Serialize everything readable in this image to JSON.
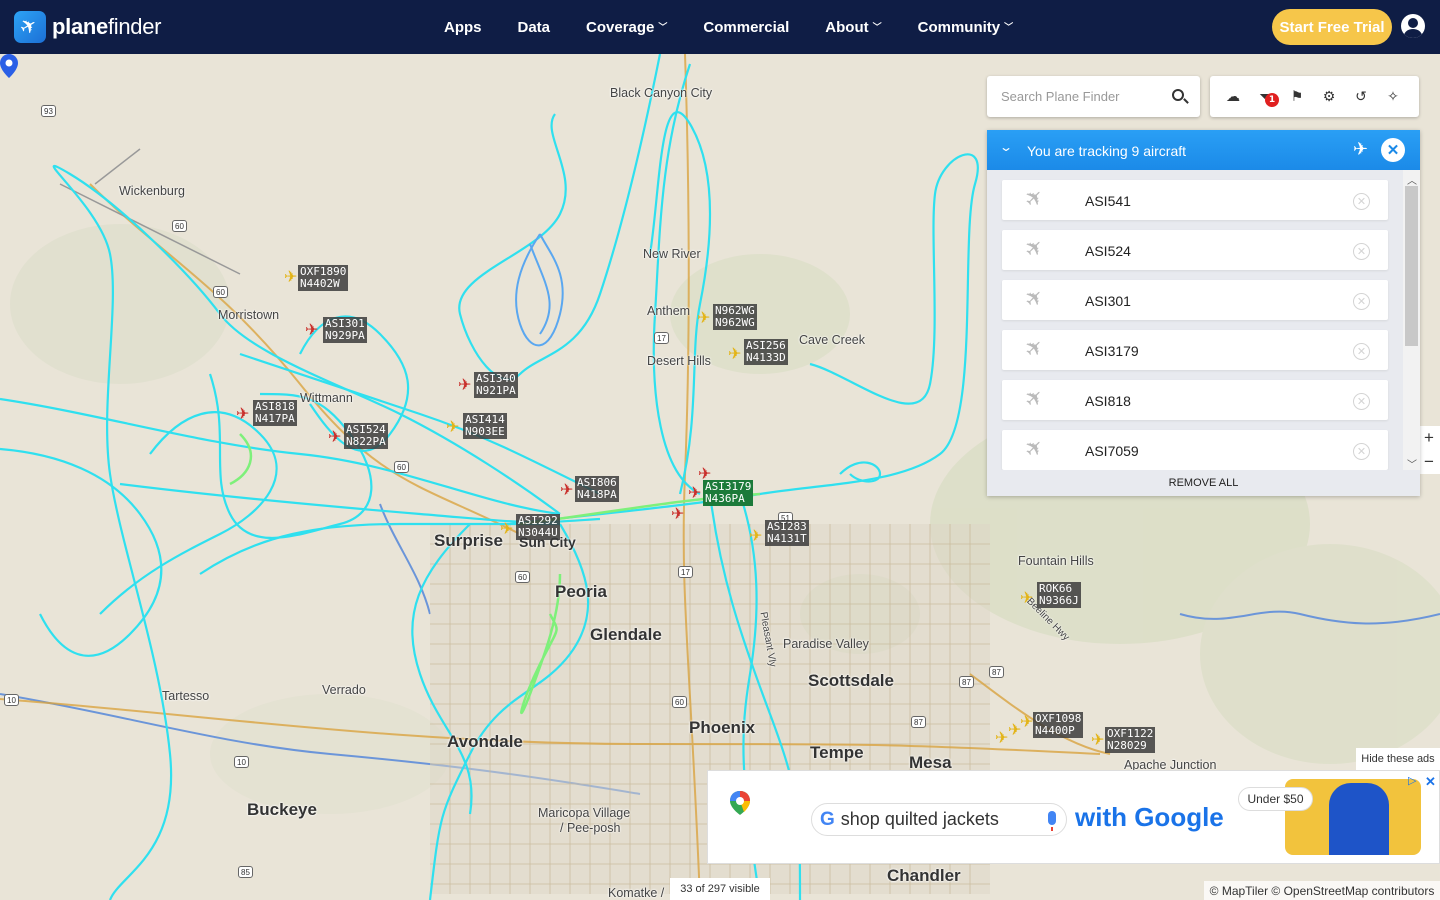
{
  "brand": {
    "name_bold": "plane",
    "name_rest": "finder"
  },
  "nav": {
    "items": [
      {
        "label": "Apps",
        "dropdown": false
      },
      {
        "label": "Data",
        "dropdown": false
      },
      {
        "label": "Coverage",
        "dropdown": true
      },
      {
        "label": "Commercial",
        "dropdown": false
      },
      {
        "label": "About",
        "dropdown": true
      },
      {
        "label": "Community",
        "dropdown": true
      }
    ],
    "cta": "Start Free Trial",
    "user_icon": "user-circle-icon"
  },
  "search": {
    "placeholder": "Search Plane Finder"
  },
  "toolbar": {
    "icons": [
      "cloud-upload-icon",
      "filter-icon",
      "bookmark-icon",
      "settings-icon",
      "history-icon",
      "layers-icon"
    ],
    "filter_badge": "1"
  },
  "tracking": {
    "title": "You are tracking 9 aircraft",
    "aircraft": [
      "ASI541",
      "ASI524",
      "ASI301",
      "ASI3179",
      "ASI818",
      "ASI7059"
    ],
    "remove_all": "REMOVE ALL"
  },
  "map": {
    "places": [
      {
        "name": "Black Canyon City",
        "size": "med"
      },
      {
        "name": "Wickenburg",
        "size": "med"
      },
      {
        "name": "New River",
        "size": "med"
      },
      {
        "name": "Anthem",
        "size": "med"
      },
      {
        "name": "Cave Creek",
        "size": "med"
      },
      {
        "name": "Desert Hills",
        "size": "med"
      },
      {
        "name": "Morristown",
        "size": "med"
      },
      {
        "name": "Wittmann",
        "size": "med"
      },
      {
        "name": "Surprise",
        "size": "big"
      },
      {
        "name": "Sun City",
        "size": "big"
      },
      {
        "name": "Peoria",
        "size": "big"
      },
      {
        "name": "Glendale",
        "size": "big"
      },
      {
        "name": "Fountain Hills",
        "size": "med"
      },
      {
        "name": "Paradise Valley",
        "size": "med"
      },
      {
        "name": "Scottsdale",
        "size": "big"
      },
      {
        "name": "Tartesso",
        "size": "med"
      },
      {
        "name": "Verrado",
        "size": "med"
      },
      {
        "name": "Avondale",
        "size": "big"
      },
      {
        "name": "Phoenix",
        "size": "big"
      },
      {
        "name": "Tempe",
        "size": "big"
      },
      {
        "name": "Mesa",
        "size": "big"
      },
      {
        "name": "Apache Junction",
        "size": "med"
      },
      {
        "name": "Buckeye",
        "size": "big"
      },
      {
        "name": "Maricopa Village",
        "size": "med"
      },
      {
        "name": "/ Pee-posh",
        "size": "med"
      },
      {
        "name": "Chandler",
        "size": "big"
      },
      {
        "name": "Komatke /",
        "size": "med"
      },
      {
        "name": "Pleasant Vly",
        "size": "med"
      },
      {
        "name": "Beeline Hwy",
        "size": "med"
      }
    ],
    "highways": [
      "93",
      "60",
      "60",
      "60",
      "60",
      "60",
      "17",
      "17",
      "51",
      "87",
      "87",
      "87",
      "10",
      "10",
      "85"
    ],
    "aircraft_labels": [
      {
        "callsign": "OXF1890",
        "reg": "N4402W",
        "color": "yellow"
      },
      {
        "callsign": "ASI301",
        "reg": "N929PA",
        "color": "red"
      },
      {
        "callsign": "ASI340",
        "reg": "N921PA",
        "color": "red"
      },
      {
        "callsign": "ASI818",
        "reg": "N417PA",
        "color": "red"
      },
      {
        "callsign": "ASI524",
        "reg": "N822PA",
        "color": "red"
      },
      {
        "callsign": "ASI414",
        "reg": "N903EE",
        "color": "yellow"
      },
      {
        "callsign": "N962WG",
        "reg": "N962WG",
        "color": "yellow"
      },
      {
        "callsign": "ASI256",
        "reg": "N4133D",
        "color": "yellow"
      },
      {
        "callsign": "ASI806",
        "reg": "N418PA",
        "color": "red"
      },
      {
        "callsign": "ASI3179",
        "reg": "N436PA",
        "color": "red",
        "selected": true
      },
      {
        "callsign": "ASI292",
        "reg": "N3044U",
        "color": "yellow"
      },
      {
        "callsign": "ASI283",
        "reg": "N4131T",
        "color": "yellow"
      },
      {
        "callsign": "ROK66",
        "reg": "N9366J",
        "color": "yellow"
      },
      {
        "callsign": "OXF1098",
        "reg": "N4400P",
        "color": "yellow"
      },
      {
        "callsign": "OXF1122",
        "reg": "N28029",
        "color": "yellow"
      }
    ],
    "track_color": "#2fe0ef",
    "track_color_alt": "#7ef07a",
    "visible_count": "33 of 297 visible",
    "attribution": "© MapTiler © OpenStreetMap contributors"
  },
  "ad": {
    "hide_label": "Hide these ads",
    "query": "shop quilted jackets",
    "with": "with Google",
    "price": "Under $50"
  }
}
